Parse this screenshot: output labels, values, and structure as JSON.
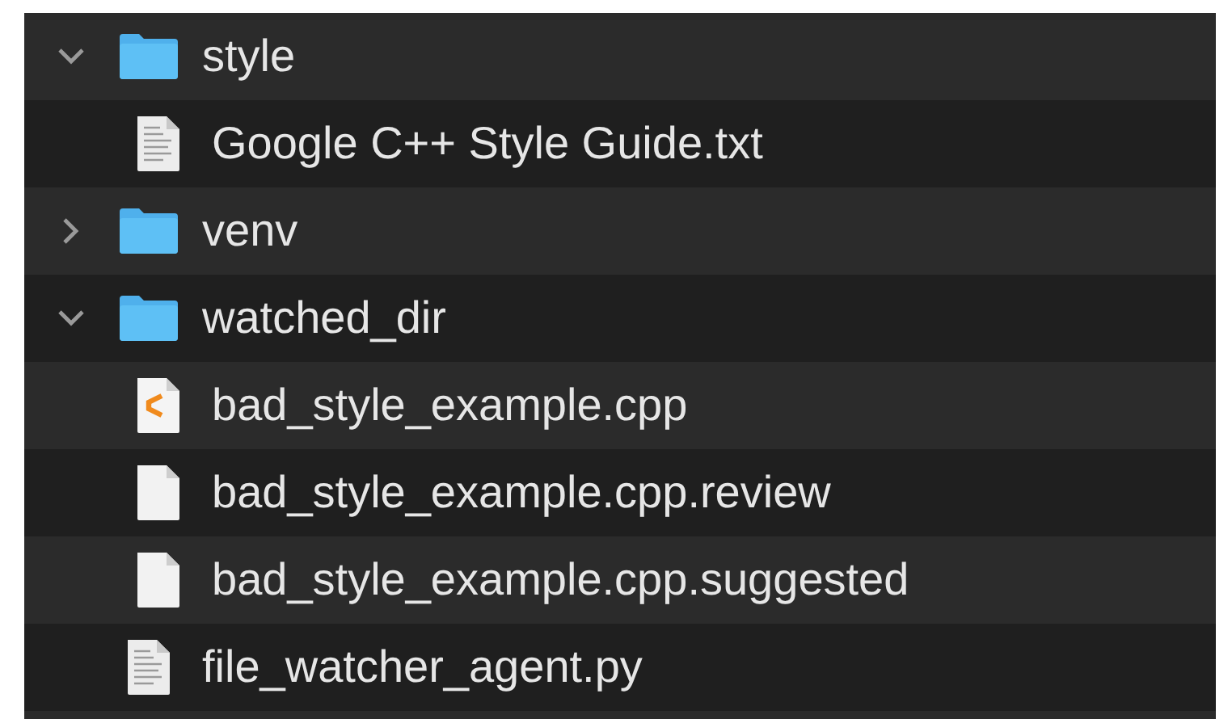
{
  "items": [
    {
      "name": "style",
      "kind": "folder",
      "expanded": true,
      "children": [
        {
          "name": "Google C++ Style Guide.txt",
          "kind": "text-document"
        }
      ]
    },
    {
      "name": "venv",
      "kind": "folder",
      "expanded": false
    },
    {
      "name": "watched_dir",
      "kind": "folder",
      "expanded": true,
      "children": [
        {
          "name": "bad_style_example.cpp",
          "kind": "source"
        },
        {
          "name": "bad_style_example.cpp.review",
          "kind": "blank"
        },
        {
          "name": "bad_style_example.cpp.suggested",
          "kind": "blank"
        }
      ]
    },
    {
      "name": "file_watcher_agent.py",
      "kind": "text-document"
    }
  ]
}
